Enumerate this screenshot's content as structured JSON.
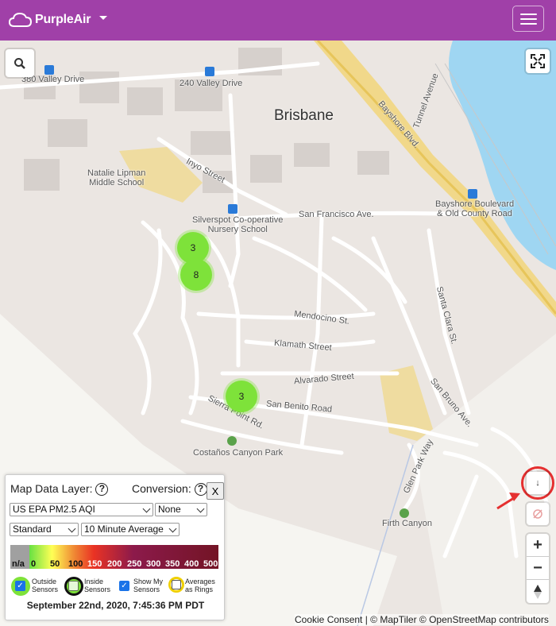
{
  "header": {
    "brand": "PurpleAir",
    "logo_icon": "cloud-icon",
    "menu_icon": "hamburger-menu-icon"
  },
  "map": {
    "place_name": "Brisbane",
    "labels": {
      "valley_380": "380 Valley Drive",
      "valley_240": "240 Valley Drive",
      "school": "Natalie Lipman\nMiddle School",
      "inyo": "Inyo Street",
      "bayshore_blvd": "Bayshore Blvd.",
      "tunnel": "Tunnel Avenue",
      "bayshore_stop": "Bayshore Boulevard\n& Old County Road",
      "silverspot": "Silverspot Co-operative\nNursery School",
      "sf_ave": "San Francisco Ave.",
      "mendocino": "Mendocino St.",
      "klamath": "Klamath Street",
      "alvarado": "Alvarado Street",
      "santa_clara": "Santa Clara St.",
      "san_benito": "San Benito Road",
      "sierra_point": "Sierra Point Rd.",
      "san_bruno": "San Bruno Ave.",
      "glen_park": "Glen Park Way",
      "costanos": "Costaños Canyon Park",
      "firth": "Firth Canyon"
    },
    "clusters": [
      "3",
      "8",
      "3"
    ]
  },
  "controls": {
    "search_icon": "search-icon",
    "fullscreen_icon": "fullscreen-icon",
    "download_icon": "download-icon",
    "location_icon": "location-disabled-icon",
    "zoom_in": "+",
    "zoom_out": "−",
    "compass_icon": "compass-icon"
  },
  "panel": {
    "layer_label": "Map Data Layer:",
    "conversion_label": "Conversion:",
    "help": "?",
    "close": "X",
    "layer_value": "US EPA PM2.5 AQI",
    "conversion_value": "None",
    "style_value": "Standard",
    "average_value": "10 Minute Average",
    "scale": [
      "n/a",
      "0",
      "50",
      "100",
      "150",
      "200",
      "250",
      "300",
      "350",
      "400",
      "500"
    ],
    "legend": {
      "outside": "Outside\nSensors",
      "inside": "Inside\nSensors",
      "show_my": "Show My\nSensors",
      "averages": "Averages\nas Rings"
    },
    "date": "September 22nd, 2020, 7:45:36 PM PDT"
  },
  "attribution": "Cookie Consent | © MapTiler © OpenStreetMap contributors",
  "colors": {
    "header": "#a040a8",
    "cluster": "#7ee23a",
    "water": "#9fd6f2",
    "highlight": "#e53030"
  }
}
